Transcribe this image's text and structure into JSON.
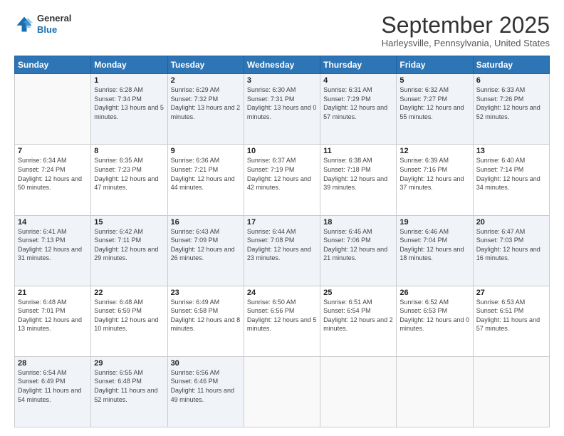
{
  "header": {
    "logo_line1": "General",
    "logo_line2": "Blue",
    "month": "September 2025",
    "location": "Harleysville, Pennsylvania, United States"
  },
  "weekdays": [
    "Sunday",
    "Monday",
    "Tuesday",
    "Wednesday",
    "Thursday",
    "Friday",
    "Saturday"
  ],
  "weeks": [
    [
      null,
      {
        "day": "1",
        "sunrise": "6:28 AM",
        "sunset": "7:34 PM",
        "daylight": "13 hours and 5 minutes."
      },
      {
        "day": "2",
        "sunrise": "6:29 AM",
        "sunset": "7:32 PM",
        "daylight": "13 hours and 2 minutes."
      },
      {
        "day": "3",
        "sunrise": "6:30 AM",
        "sunset": "7:31 PM",
        "daylight": "13 hours and 0 minutes."
      },
      {
        "day": "4",
        "sunrise": "6:31 AM",
        "sunset": "7:29 PM",
        "daylight": "12 hours and 57 minutes."
      },
      {
        "day": "5",
        "sunrise": "6:32 AM",
        "sunset": "7:27 PM",
        "daylight": "12 hours and 55 minutes."
      },
      {
        "day": "6",
        "sunrise": "6:33 AM",
        "sunset": "7:26 PM",
        "daylight": "12 hours and 52 minutes."
      }
    ],
    [
      {
        "day": "7",
        "sunrise": "6:34 AM",
        "sunset": "7:24 PM",
        "daylight": "12 hours and 50 minutes."
      },
      {
        "day": "8",
        "sunrise": "6:35 AM",
        "sunset": "7:23 PM",
        "daylight": "12 hours and 47 minutes."
      },
      {
        "day": "9",
        "sunrise": "6:36 AM",
        "sunset": "7:21 PM",
        "daylight": "12 hours and 44 minutes."
      },
      {
        "day": "10",
        "sunrise": "6:37 AM",
        "sunset": "7:19 PM",
        "daylight": "12 hours and 42 minutes."
      },
      {
        "day": "11",
        "sunrise": "6:38 AM",
        "sunset": "7:18 PM",
        "daylight": "12 hours and 39 minutes."
      },
      {
        "day": "12",
        "sunrise": "6:39 AM",
        "sunset": "7:16 PM",
        "daylight": "12 hours and 37 minutes."
      },
      {
        "day": "13",
        "sunrise": "6:40 AM",
        "sunset": "7:14 PM",
        "daylight": "12 hours and 34 minutes."
      }
    ],
    [
      {
        "day": "14",
        "sunrise": "6:41 AM",
        "sunset": "7:13 PM",
        "daylight": "12 hours and 31 minutes."
      },
      {
        "day": "15",
        "sunrise": "6:42 AM",
        "sunset": "7:11 PM",
        "daylight": "12 hours and 29 minutes."
      },
      {
        "day": "16",
        "sunrise": "6:43 AM",
        "sunset": "7:09 PM",
        "daylight": "12 hours and 26 minutes."
      },
      {
        "day": "17",
        "sunrise": "6:44 AM",
        "sunset": "7:08 PM",
        "daylight": "12 hours and 23 minutes."
      },
      {
        "day": "18",
        "sunrise": "6:45 AM",
        "sunset": "7:06 PM",
        "daylight": "12 hours and 21 minutes."
      },
      {
        "day": "19",
        "sunrise": "6:46 AM",
        "sunset": "7:04 PM",
        "daylight": "12 hours and 18 minutes."
      },
      {
        "day": "20",
        "sunrise": "6:47 AM",
        "sunset": "7:03 PM",
        "daylight": "12 hours and 16 minutes."
      }
    ],
    [
      {
        "day": "21",
        "sunrise": "6:48 AM",
        "sunset": "7:01 PM",
        "daylight": "12 hours and 13 minutes."
      },
      {
        "day": "22",
        "sunrise": "6:48 AM",
        "sunset": "6:59 PM",
        "daylight": "12 hours and 10 minutes."
      },
      {
        "day": "23",
        "sunrise": "6:49 AM",
        "sunset": "6:58 PM",
        "daylight": "12 hours and 8 minutes."
      },
      {
        "day": "24",
        "sunrise": "6:50 AM",
        "sunset": "6:56 PM",
        "daylight": "12 hours and 5 minutes."
      },
      {
        "day": "25",
        "sunrise": "6:51 AM",
        "sunset": "6:54 PM",
        "daylight": "12 hours and 2 minutes."
      },
      {
        "day": "26",
        "sunrise": "6:52 AM",
        "sunset": "6:53 PM",
        "daylight": "12 hours and 0 minutes."
      },
      {
        "day": "27",
        "sunrise": "6:53 AM",
        "sunset": "6:51 PM",
        "daylight": "11 hours and 57 minutes."
      }
    ],
    [
      {
        "day": "28",
        "sunrise": "6:54 AM",
        "sunset": "6:49 PM",
        "daylight": "11 hours and 54 minutes."
      },
      {
        "day": "29",
        "sunrise": "6:55 AM",
        "sunset": "6:48 PM",
        "daylight": "11 hours and 52 minutes."
      },
      {
        "day": "30",
        "sunrise": "6:56 AM",
        "sunset": "6:46 PM",
        "daylight": "11 hours and 49 minutes."
      },
      null,
      null,
      null,
      null
    ]
  ]
}
